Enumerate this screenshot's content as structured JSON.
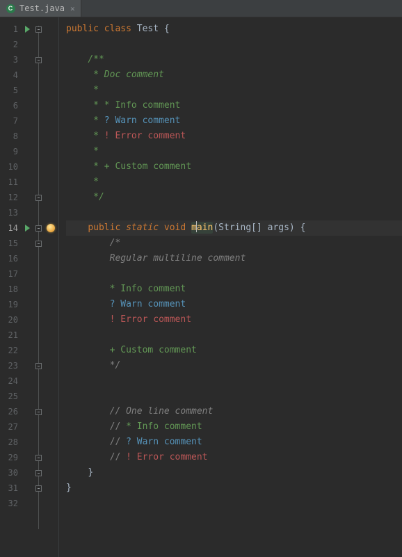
{
  "tab": {
    "filename": "Test.java",
    "icon_letter": "C"
  },
  "icons": {
    "run": "run-icon",
    "fold": "fold-toggle-icon",
    "bulb": "intention-bulb-icon",
    "close": "close-icon"
  },
  "editor": {
    "current_line": 14,
    "line_count": 32,
    "caret_col_marker": "m|ain"
  },
  "code": {
    "l1_public": "public",
    "l1_class": "class",
    "l1_name": "Test",
    "l1_brace": " {",
    "l3": "/**",
    "l4": " * Doc comment",
    "l5": " *",
    "l6_pre": " * ",
    "l6_tag": "*",
    "l6_txt": " Info comment",
    "l7_pre": " * ",
    "l7_tag": "?",
    "l7_txt": " Warn comment",
    "l8_pre": " * ",
    "l8_tag": "!",
    "l8_txt": " Error comment",
    "l9": " *",
    "l10_pre": " * ",
    "l10_tag": "+",
    "l10_txt": " Custom comment",
    "l11": " *",
    "l12": " */",
    "l14_public": "public",
    "l14_static": "static",
    "l14_void": "void",
    "l14_m": "m",
    "l14_ain": "ain",
    "l14_sig": "(String[] args) {",
    "l15": "/*",
    "l16": "Regular multiline comment",
    "l18_tag": "*",
    "l18_txt": " Info comment",
    "l19_tag": "?",
    "l19_txt": " Warn comment",
    "l20_tag": "!",
    "l20_txt": " Error comment",
    "l22_tag": "+",
    "l22_txt": " Custom comment",
    "l23": "*/",
    "l26": "// One line comment",
    "l27_pre": "// ",
    "l27_tag": "*",
    "l27_txt": " Info comment",
    "l28_pre": "// ",
    "l28_tag": "?",
    "l28_txt": " Warn comment",
    "l29_pre": "// ",
    "l29_tag": "!",
    "l29_txt": " Error comment",
    "l30": "}",
    "l31": "}"
  },
  "colors": {
    "background": "#2b2b2b",
    "gutter": "#313335",
    "keyword": "#cc7832",
    "doc": "#629755",
    "comment": "#808080",
    "warn": "#5693b9",
    "error": "#bc5757",
    "method": "#ffc66d",
    "text": "#a9b7c6"
  }
}
